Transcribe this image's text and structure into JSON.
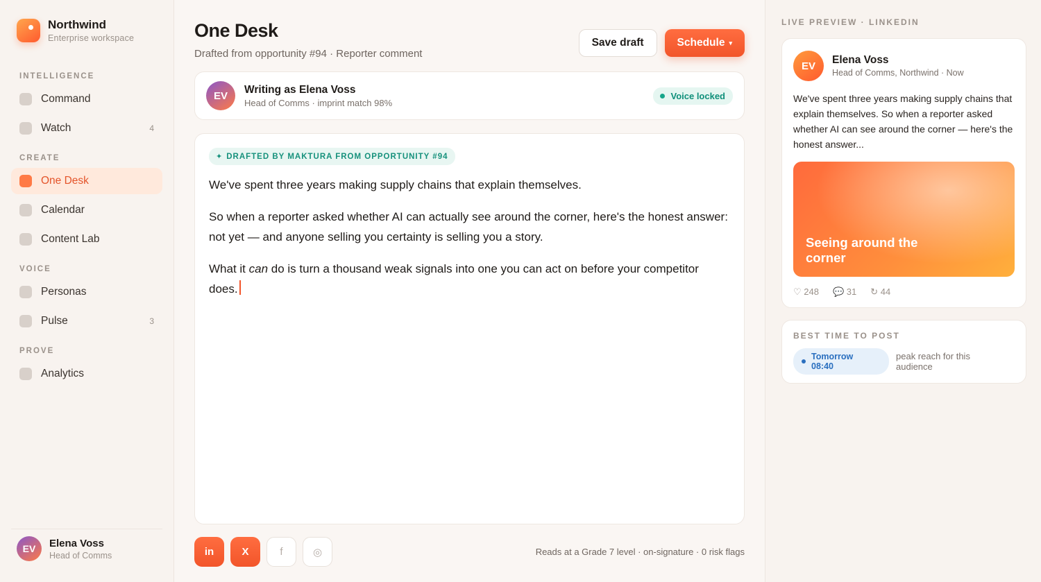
{
  "brand": {
    "name": "Northwind",
    "sub": "Enterprise workspace"
  },
  "nav": {
    "sections": [
      {
        "label": "INTELLIGENCE",
        "items": [
          {
            "label": "Command",
            "count": ""
          },
          {
            "label": "Watch",
            "count": "4"
          }
        ]
      },
      {
        "label": "CREATE",
        "items": [
          {
            "label": "One Desk",
            "count": ""
          },
          {
            "label": "Calendar",
            "count": ""
          },
          {
            "label": "Content Lab",
            "count": ""
          }
        ]
      },
      {
        "label": "VOICE",
        "items": [
          {
            "label": "Personas",
            "count": ""
          },
          {
            "label": "Pulse",
            "count": "3"
          }
        ]
      },
      {
        "label": "PROVE",
        "items": [
          {
            "label": "Analytics",
            "count": ""
          }
        ]
      }
    ],
    "active": "One Desk"
  },
  "profile": {
    "initials": "EV",
    "name": "Elena Voss",
    "role": "Head of Comms"
  },
  "header": {
    "title": "One Desk",
    "subtitle": "Drafted from opportunity #94 · Reporter comment",
    "save_label": "Save draft",
    "schedule_label": "Schedule",
    "schedule_caret": "▾"
  },
  "writer": {
    "initials": "EV",
    "title": "Writing as Elena Voss",
    "subtitle": "Head of Comms · imprint match 98%",
    "badge": "Voice locked"
  },
  "editor": {
    "badge_icon": "✦",
    "badge": "DRAFTED BY MAKTURA FROM OPPORTUNITY #94",
    "p1": "We've spent three years making supply chains that explain themselves.",
    "p2": "So when a reporter asked whether AI can actually see around the corner, here's the honest answer: not yet — and anyone selling you certainty is selling you a story.",
    "p3_pre": "What it ",
    "p3_em": "can",
    "p3_post": " do is turn a thousand weak signals into one you can act on before your competitor does."
  },
  "channels": [
    {
      "label": "in",
      "icon": "linkedin-icon",
      "active": true
    },
    {
      "label": "X",
      "icon": "x-icon",
      "active": true
    },
    {
      "label": "f",
      "icon": "facebook-icon",
      "active": false
    },
    {
      "label": "◎",
      "icon": "instagram-icon",
      "active": false
    }
  ],
  "bottom_stats": "Reads at a Grade 7 level · on-signature · 0 risk flags",
  "preview": {
    "label": "LIVE PREVIEW · LINKEDIN",
    "initials": "EV",
    "name": "Elena Voss",
    "role": "Head of Comms, Northwind · Now",
    "body": "We've spent three years making supply chains that explain themselves. So when a reporter asked whether AI can see around the corner — here's the honest answer...",
    "image_text": "Seeing around the corner",
    "likes": "♡ 248",
    "comments": "💬 31",
    "shares": "↻ 44"
  },
  "best_time": {
    "label": "BEST TIME TO POST",
    "day": "Tomorrow",
    "time": "08:40",
    "note": "peak reach for this audience"
  },
  "colors": {
    "accent": "#f2552a",
    "active_bg": "#ffe9dc",
    "voice_green": "#15a58a",
    "time_blue": "#2a6fbf"
  }
}
